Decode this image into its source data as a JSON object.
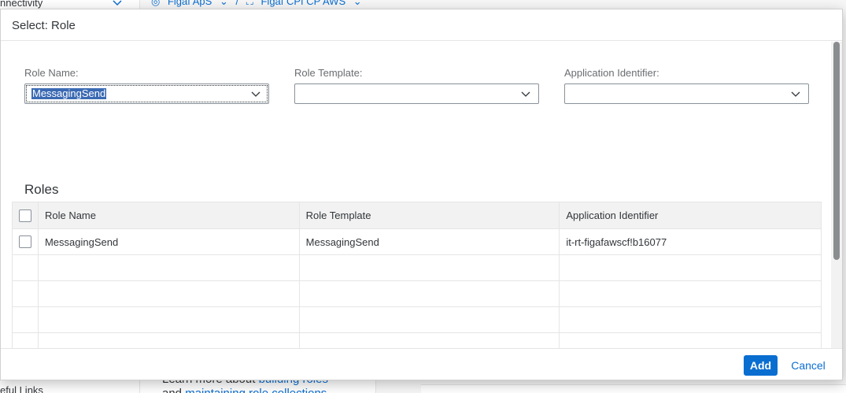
{
  "background": {
    "sidebar_top": "nnectivity",
    "sidebar_bottom": "eful Links",
    "breadcrumbs": [
      "Figaf ApS",
      "Figaf CPI CP AWS"
    ],
    "learn_more_prefix": "Learn more about",
    "learn_more_link1": "building roles",
    "learn_more_and": "and",
    "learn_more_link2": "maintaining role collections"
  },
  "dialog": {
    "title": "Select: Role",
    "filters": {
      "role_name_label": "Role Name:",
      "role_name_value": "MessagingSend",
      "role_template_label": "Role Template:",
      "role_template_value": "",
      "app_id_label": "Application Identifier:",
      "app_id_value": ""
    },
    "roles_title": "Roles",
    "table": {
      "columns": [
        "Role Name",
        "Role Template",
        "Application Identifier"
      ],
      "rows": [
        [
          "MessagingSend",
          "MessagingSend",
          "it-rt-figafawscf!b16077"
        ]
      ]
    },
    "footer": {
      "add_label": "Add",
      "cancel_label": "Cancel"
    }
  }
}
